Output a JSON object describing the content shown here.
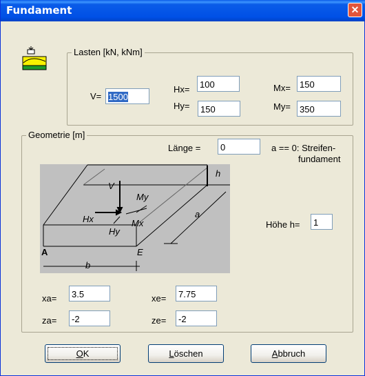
{
  "window": {
    "title": "Fundament",
    "close_glyph": "✕"
  },
  "lasten": {
    "legend": "Lasten [kN, kNm]",
    "V": {
      "label": "V=",
      "value": "1500"
    },
    "Hx": {
      "label": "Hx=",
      "value": "100"
    },
    "Hy": {
      "label": "Hy=",
      "value": "150"
    },
    "Mx": {
      "label": "Mx=",
      "value": "150"
    },
    "My": {
      "label": "My=",
      "value": "350"
    }
  },
  "geometrie": {
    "legend": "Geometrie [m]",
    "laenge": {
      "label": "Länge =",
      "value": "0"
    },
    "note_line1": "a == 0: Streifen-",
    "note_line2": "fundament",
    "hoehe": {
      "label": "Höhe h=",
      "value": "1"
    },
    "xa": {
      "label": "xa=",
      "value": "3.5"
    },
    "za": {
      "label": "za=",
      "value": "-2"
    },
    "xe": {
      "label": "xe=",
      "value": "7.75"
    },
    "ze": {
      "label": "ze=",
      "value": "-2"
    }
  },
  "drawing_labels": {
    "V": "V",
    "My": "My",
    "Hx": "Hx",
    "Mx": "Mx",
    "Hy": "Hy",
    "h": "h",
    "a": "a",
    "b": "b",
    "A": "A",
    "E": "E"
  },
  "buttons": {
    "ok_accel": "O",
    "ok_rest": "K",
    "loeschen_accel": "L",
    "loeschen_rest": "öschen",
    "abbruch_accel": "A",
    "abbruch_rest": "bbruch"
  },
  "icons": {
    "window_icon": "foundation-icon"
  }
}
